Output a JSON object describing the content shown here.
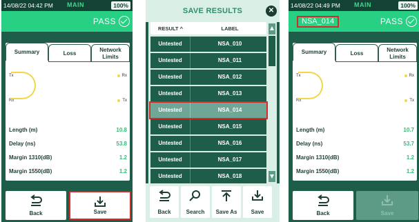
{
  "screen1": {
    "status": {
      "time": "14/08/22 04:42 PM",
      "mode": "MAIN",
      "battery": "100%"
    },
    "header": {
      "status": "PASS"
    },
    "tabs": [
      "Summary",
      "Loss",
      "Network",
      "Limits"
    ],
    "ports": {
      "tx_left": "Tx",
      "rx_left": "Rx",
      "rx_right": "Rx",
      "tx_right": "Tx"
    },
    "measurements": [
      {
        "label": "Length (m)",
        "value": "10.8"
      },
      {
        "label": "Delay (ns)",
        "value": "53.8"
      },
      {
        "label": "Margin 1310(dB)",
        "value": "1.2"
      },
      {
        "label": "Margin 1550(dB)",
        "value": "1.2"
      }
    ],
    "buttons": {
      "back": "Back",
      "save": "Save"
    }
  },
  "dialog": {
    "title": "SAVE RESULTS",
    "columns": {
      "result": "RESULT",
      "label": "LABEL"
    },
    "sort_indicator": "^",
    "rows": [
      {
        "result": "Untested",
        "label": "NSA_010"
      },
      {
        "result": "Untested",
        "label": "NSA_011"
      },
      {
        "result": "Untested",
        "label": "NSA_012"
      },
      {
        "result": "Untested",
        "label": "NSA_013"
      },
      {
        "result": "Untested",
        "label": "NSA_014"
      },
      {
        "result": "Untested",
        "label": "NSA_015"
      },
      {
        "result": "Untested",
        "label": "NSA_016"
      },
      {
        "result": "Untested",
        "label": "NSA_017"
      },
      {
        "result": "Untested",
        "label": "NSA_018"
      }
    ],
    "selected_row": 4,
    "buttons": {
      "back": "Back",
      "search": "Search",
      "save_as": "Save As",
      "save": "Save"
    }
  },
  "screen3": {
    "status": {
      "time": "14/08/22 04:49 PM",
      "mode": "MAIN",
      "battery": "100%"
    },
    "header": {
      "label": "NSA_014",
      "status": "PASS"
    },
    "tabs": [
      "Summary",
      "Loss",
      "Network",
      "Limits"
    ],
    "ports": {
      "tx_left": "Tx",
      "rx_left": "Rx",
      "rx_right": "Rx",
      "tx_right": "Tx"
    },
    "measurements": [
      {
        "label": "Length (m)",
        "value": "10.7"
      },
      {
        "label": "Delay (ns)",
        "value": "53.7"
      },
      {
        "label": "Margin 1310(dB)",
        "value": "1.2"
      },
      {
        "label": "Margin 1550(dB)",
        "value": "1.2"
      }
    ],
    "buttons": {
      "back": "Back",
      "save": "Save"
    }
  },
  "colors": {
    "accent": "#27d083",
    "panel": "#1e5d4a",
    "highlight": "#d42a2a",
    "value": "#3ab878"
  }
}
